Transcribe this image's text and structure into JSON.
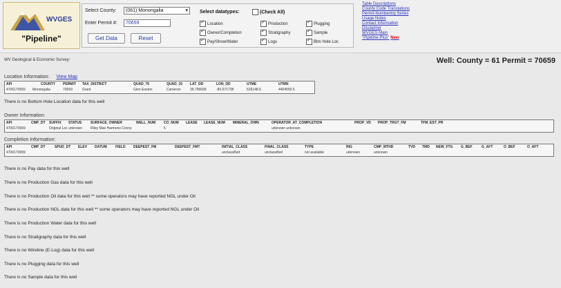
{
  "header": {
    "logo": {
      "agency": "WVGES",
      "app_name": "\"Pipeline\""
    },
    "search": {
      "county_label": "Select County:",
      "county_value": "(061) Monongalia",
      "permit_label": "Enter Permit #:",
      "permit_value": "70659",
      "get_data_label": "Get Data",
      "reset_label": "Reset"
    },
    "datatypes": {
      "title": "Select datatypes:",
      "check_all_label": "(Check All)",
      "items": [
        {
          "label": "Location",
          "checked": true
        },
        {
          "label": "Production",
          "checked": true
        },
        {
          "label": "Plugging",
          "checked": true
        },
        {
          "label": "Owner/Completion",
          "checked": true
        },
        {
          "label": "Stratigraphy",
          "checked": true
        },
        {
          "label": "Sample",
          "checked": true
        },
        {
          "label": "Pay/Show/Water",
          "checked": true
        },
        {
          "label": "Logs",
          "checked": true
        },
        {
          "label": "Btm Hole Loc",
          "checked": true
        }
      ]
    },
    "links": [
      "Table Descriptions",
      "County Code Translations",
      "Permit-Numbering Series",
      "Usage Notes",
      "Contact Information",
      "Disclaimer",
      "WVGES Main",
      "\"Pipeline-Plus\""
    ],
    "new_badge": "New"
  },
  "survey_label": "WV Geological & Economic Survey:",
  "well_title": "Well:  County = 61 Permit = 70659",
  "location": {
    "label": "Location Information:",
    "map_link": "View Map",
    "headers": [
      "API",
      "COUNTY",
      "PERMIT",
      "TAX_DISTRICT",
      "QUAD_75",
      "QUAD_15",
      "LAT_DD",
      "LON_DD",
      "UTME",
      "UTMN"
    ],
    "values": [
      "4706170659",
      "Monongalia",
      "70659",
      "Grant",
      "Glen Easton",
      "Cameron",
      "39.795658",
      "-80.671738",
      "529148.6",
      "4404559.5"
    ]
  },
  "no_bottom_hole": "There is no Bottom Hole Location data for this well",
  "owner": {
    "label": "Owner Information:",
    "headers": [
      "API",
      "CMP_DT",
      "SUFFIX",
      "STATUS",
      "SURFACE_OWNER",
      "WELL_NUM",
      "CO_NUM",
      "LEASE",
      "LEASE_NUM",
      "MINERAL_OWN",
      "OPERATOR_AT_COMPLETION",
      "PROP_VD",
      "PROP_TRGT_FM",
      "TFM_EST_PR"
    ],
    "values": [
      "4706170659",
      "",
      "Original Loc",
      "unknown",
      "Riley Mae Harmens Conny",
      "",
      "5",
      "",
      "",
      "",
      "unknown unknown",
      "",
      "",
      ""
    ]
  },
  "completion": {
    "label": "Completion Information:",
    "headers": [
      "API",
      "CMP_DT",
      "SPUD_DT",
      "ELEV",
      "DATUM",
      "FIELD",
      "DEEPEST_FM",
      "DEEPEST_FMT",
      "INITIAL_CLASS",
      "FINAL_CLASS",
      "TYPE",
      "RIG",
      "CMP_MTHD",
      "TVD",
      "TMD",
      "NEW_FTG",
      "G_BEF",
      "G_AFT",
      "O_BEF",
      "O_AFT"
    ],
    "values": [
      "4706170659",
      "",
      "",
      "",
      "",
      "",
      "",
      "",
      "unclassified",
      "unclassified",
      "not available",
      "unknown",
      "unknown",
      "",
      "",
      "",
      "",
      "",
      "",
      ""
    ]
  },
  "messages": [
    "There is no Pay data for this well",
    "There is no Production Gas data for this well",
    "There is no Production Oil data for this well   ** some operators may have reported NGL under Oil",
    "There is no Production NGL data for this well   ** some operators may have reported NGL under Oil",
    "There is no Production Water data for this well",
    "There is no Stratigraphy data for this well",
    "There is no Wireline (E-Log) data for this well",
    "There is no Plugging data for this well",
    "There is no Sample data for this well"
  ]
}
